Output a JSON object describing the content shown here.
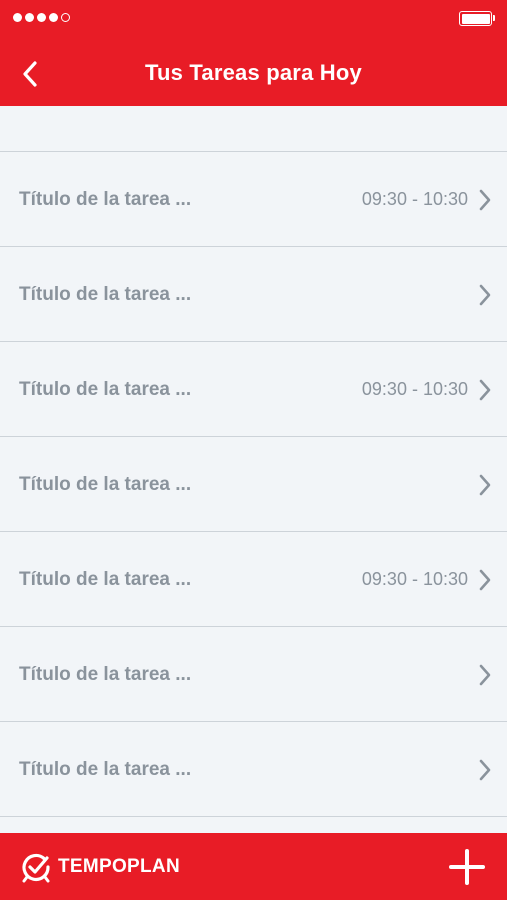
{
  "header": {
    "title": "Tus Tareas para Hoy",
    "back_icon": "chevron-left-icon"
  },
  "tasks": [
    {
      "title": "Título de la tarea ...",
      "time": "09:30 - 10:30"
    },
    {
      "title": "Título de la tarea ...",
      "time": ""
    },
    {
      "title": "Título de la tarea ...",
      "time": "09:30 - 10:30"
    },
    {
      "title": "Título de la tarea ...",
      "time": ""
    },
    {
      "title": "Título de la tarea ...",
      "time": "09:30 - 10:30"
    },
    {
      "title": "Título de la tarea ...",
      "time": ""
    },
    {
      "title": "Título de la tarea ...",
      "time": ""
    }
  ],
  "footer": {
    "brand": "TEMPOPLAN",
    "add_icon": "plus-icon"
  },
  "colors": {
    "accent": "#e81c26",
    "background": "#f2f5f8",
    "text_muted": "#8a939c",
    "divider": "#cdd3d9"
  }
}
